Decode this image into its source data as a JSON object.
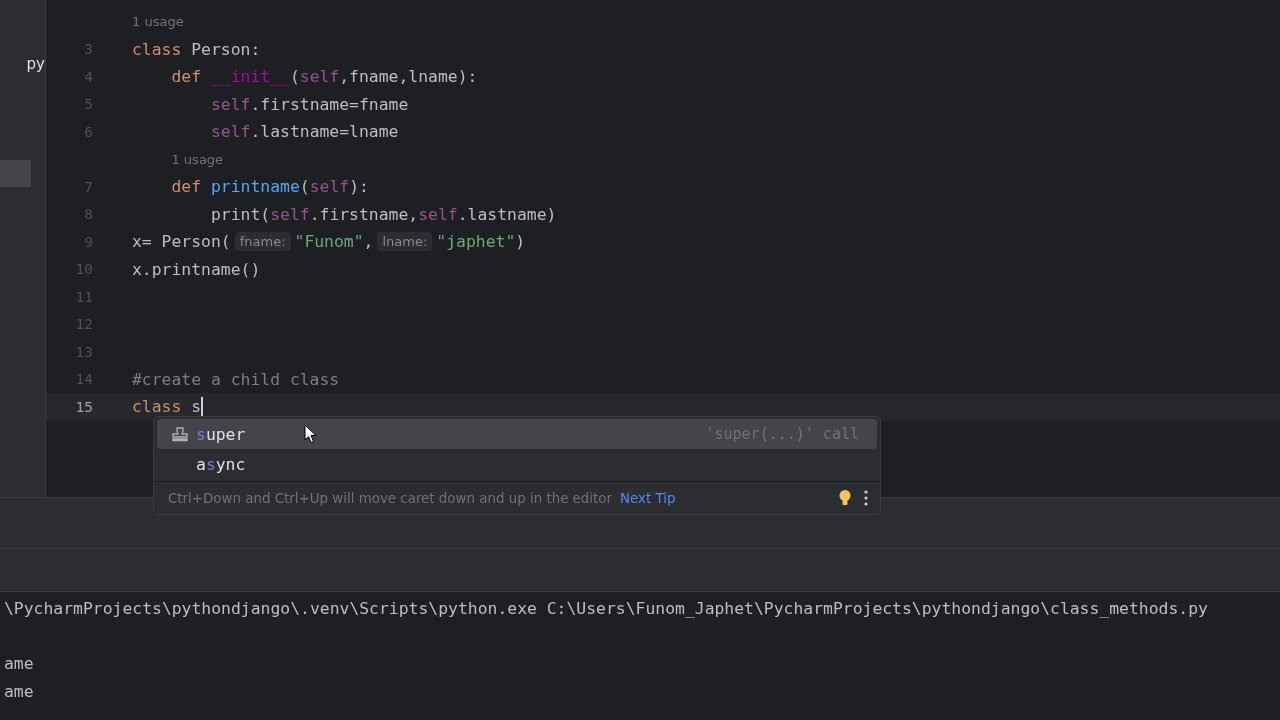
{
  "project_panel": {
    "items": [
      {
        "label": "py",
        "selected": false
      },
      {
        "selected": true
      }
    ]
  },
  "editor": {
    "lines": [
      {
        "kind": "usage",
        "text": "1 usage"
      },
      {
        "kind": "code",
        "number": "3",
        "current": false,
        "tokens": [
          {
            "t": "class",
            "kind": "keyword"
          },
          {
            "t": " Person:",
            "kind": "plain"
          }
        ],
        "children": [
          {
            "kind": "code",
            "number": "4",
            "current": false,
            "tokens": [
              {
                "t": "def",
                "kind": "keyword"
              },
              {
                "t": " __init__",
                "kind": "dunder"
              },
              {
                "t": "(",
                "kind": "plain"
              },
              {
                "t": "self",
                "kind": "self"
              },
              {
                "t": ",fname,lname):",
                "kind": "plain"
              }
            ],
            "children": [
              {
                "kind": "code",
                "number": "5",
                "current": false,
                "tokens": [
                  {
                    "t": "self",
                    "kind": "self"
                  },
                  {
                    "t": ".firstname=fname",
                    "kind": "plain"
                  }
                ]
              },
              {
                "kind": "code",
                "number": "6",
                "current": false,
                "tokens": [
                  {
                    "t": "self",
                    "kind": "self"
                  },
                  {
                    "t": ".lastname=lname",
                    "kind": "plain"
                  }
                ]
              }
            ]
          },
          {
            "kind": "usage",
            "text": "1 usage"
          },
          {
            "kind": "code",
            "number": "7",
            "current": false,
            "tokens": [
              {
                "t": "def",
                "kind": "keyword"
              },
              {
                "t": " printname",
                "kind": "function"
              },
              {
                "t": "(",
                "kind": "plain"
              },
              {
                "t": "self",
                "kind": "self"
              },
              {
                "t": "):",
                "kind": "plain"
              }
            ],
            "children": [
              {
                "kind": "code",
                "number": "8",
                "current": false,
                "tokens": [
                  {
                    "t": "print(",
                    "kind": "plain"
                  },
                  {
                    "t": "self",
                    "kind": "self"
                  },
                  {
                    "t": ".firstname,",
                    "kind": "plain"
                  },
                  {
                    "t": "self",
                    "kind": "self"
                  },
                  {
                    "t": ".lastname)",
                    "kind": "plain"
                  }
                ]
              }
            ]
          }
        ]
      },
      {
        "kind": "code",
        "number": "9",
        "current": false,
        "tokens": [
          {
            "t": "x= Person(",
            "kind": "plain"
          },
          {
            "t": "fname:",
            "kind": "inlay"
          },
          {
            "t": "\"Funom\"",
            "kind": "string"
          },
          {
            "t": ",",
            "kind": "plain"
          },
          {
            "t": "lname:",
            "kind": "inlay"
          },
          {
            "t": "\"japhet\"",
            "kind": "string"
          },
          {
            "t": ")",
            "kind": "plain"
          }
        ]
      },
      {
        "kind": "code",
        "number": "10",
        "current": false,
        "tokens": [
          {
            "t": "x.printname()",
            "kind": "plain"
          }
        ]
      },
      {
        "kind": "code",
        "number": "11",
        "current": false
      },
      {
        "kind": "code",
        "number": "12",
        "current": false
      },
      {
        "kind": "code",
        "number": "13",
        "current": false
      },
      {
        "kind": "code",
        "number": "14",
        "current": false,
        "tokens": [
          {
            "t": "#create a child class",
            "kind": "comment"
          }
        ]
      },
      {
        "kind": "code",
        "number": "15",
        "current": true,
        "tokens": [
          {
            "t": "class",
            "kind": "keyword"
          },
          {
            "t": " s",
            "kind": "plain"
          }
        ]
      }
    ]
  },
  "completion": {
    "items": [
      {
        "kind": "function",
        "match": "s",
        "after": "uper",
        "hint": "'super(...)' call",
        "selected": true
      },
      {
        "kind": "keyword",
        "before": "a",
        "match": "s",
        "after": "ync",
        "selected": false
      }
    ],
    "tip": {
      "text": "Ctrl+Down and Ctrl+Up will move caret down and up in the editor",
      "link": "Next Tip"
    }
  },
  "console": {
    "lines": [
      "\\PycharmProjects\\pythondjango\\.venv\\Scripts\\python.exe C:\\Users\\Funom_Japhet\\PycharmProjects\\pythondjango\\class_methods.py",
      "ame",
      "ame"
    ]
  }
}
